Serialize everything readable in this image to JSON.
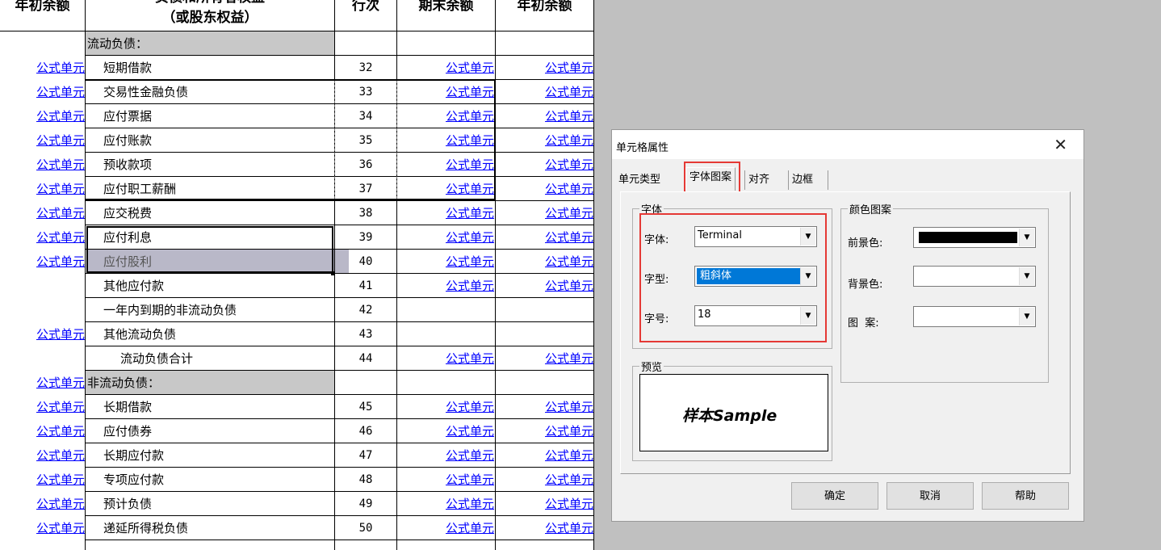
{
  "header": {
    "col1": "年初余额",
    "col2_top": "负债和所有者权益",
    "col2_bottom": "（或股东权益）",
    "col3": "行次",
    "col4": "期末余额",
    "col5": "年初余额"
  },
  "rows": [
    {
      "begin": "",
      "name": "流动负债：",
      "line": "",
      "end": "",
      "start2": "",
      "type": "sec"
    },
    {
      "begin": "公式单元",
      "name": "短期借款",
      "line": "32",
      "end": "公式单元",
      "start2": "公式单元"
    },
    {
      "begin": "公式单元",
      "name": "交易性金融负债",
      "line": "33",
      "end": "公式单元",
      "start2": "公式单元"
    },
    {
      "begin": "公式单元",
      "name": "应付票据",
      "line": "34",
      "end": "公式单元",
      "start2": "公式单元"
    },
    {
      "begin": "公式单元",
      "name": "应付账款",
      "line": "35",
      "end": "公式单元",
      "start2": "公式单元"
    },
    {
      "begin": "公式单元",
      "name": "预收款项",
      "line": "36",
      "end": "公式单元",
      "start2": "公式单元"
    },
    {
      "begin": "公式单元",
      "name": "应付职工薪酬",
      "line": "37",
      "end": "公式单元",
      "start2": "公式单元"
    },
    {
      "begin": "公式单元",
      "name": "应交税费",
      "line": "38",
      "end": "公式单元",
      "start2": "公式单元"
    },
    {
      "begin": "公式单元",
      "name": "应付利息",
      "line": "39",
      "end": "公式单元",
      "start2": "公式单元"
    },
    {
      "begin": "公式单元",
      "name": "应付股利",
      "line": "40",
      "end": "公式单元",
      "start2": "公式单元"
    },
    {
      "begin": "",
      "name": "其他应付款",
      "line": "41",
      "end": "公式单元",
      "start2": "公式单元"
    },
    {
      "begin": "",
      "name": "一年内到期的非流动负债",
      "line": "42",
      "end": "",
      "start2": ""
    },
    {
      "begin": "公式单元",
      "name": "其他流动负债",
      "line": "43",
      "end": "",
      "start2": ""
    },
    {
      "begin": "",
      "name": "流动负债合计",
      "line": "44",
      "end": "公式单元",
      "start2": "公式单元",
      "type": "ind2"
    },
    {
      "begin": "公式单元",
      "name": "非流动负债：",
      "line": "",
      "end": "",
      "start2": "",
      "type": "sec"
    },
    {
      "begin": "公式单元",
      "name": "长期借款",
      "line": "45",
      "end": "公式单元",
      "start2": "公式单元"
    },
    {
      "begin": "公式单元",
      "name": "应付债券",
      "line": "46",
      "end": "公式单元",
      "start2": "公式单元"
    },
    {
      "begin": "公式单元",
      "name": "长期应付款",
      "line": "47",
      "end": "公式单元",
      "start2": "公式单元"
    },
    {
      "begin": "公式单元",
      "name": "专项应付款",
      "line": "48",
      "end": "公式单元",
      "start2": "公式单元"
    },
    {
      "begin": "公式单元",
      "name": "预计负债",
      "line": "49",
      "end": "公式单元",
      "start2": "公式单元"
    },
    {
      "begin": "公式单元",
      "name": "递延所得税负债",
      "line": "50",
      "end": "公式单元",
      "start2": "公式单元"
    }
  ],
  "dialog": {
    "title": "单元格属性",
    "close_icon": "close-icon",
    "tabs": [
      "单元类型",
      "字体图案",
      "对齐",
      "边框"
    ],
    "active_tab": "字体图案",
    "font_group": {
      "label": "字体",
      "font_label": "字体:",
      "font_value": "Terminal",
      "style_label": "字型:",
      "style_value": "粗斜体",
      "size_label": "字号:",
      "size_value": "18"
    },
    "color_group": {
      "label": "颜色图案",
      "fg_label": "前景色:",
      "fg_color": "#000000",
      "bg_label": "背景色:",
      "pattern_label": "图  案:"
    },
    "preview_group": {
      "label": "预览",
      "sample": "样本Sample"
    },
    "buttons": {
      "ok": "确定",
      "cancel": "取消",
      "help": "帮助"
    },
    "highlight_color": "#e53935"
  }
}
